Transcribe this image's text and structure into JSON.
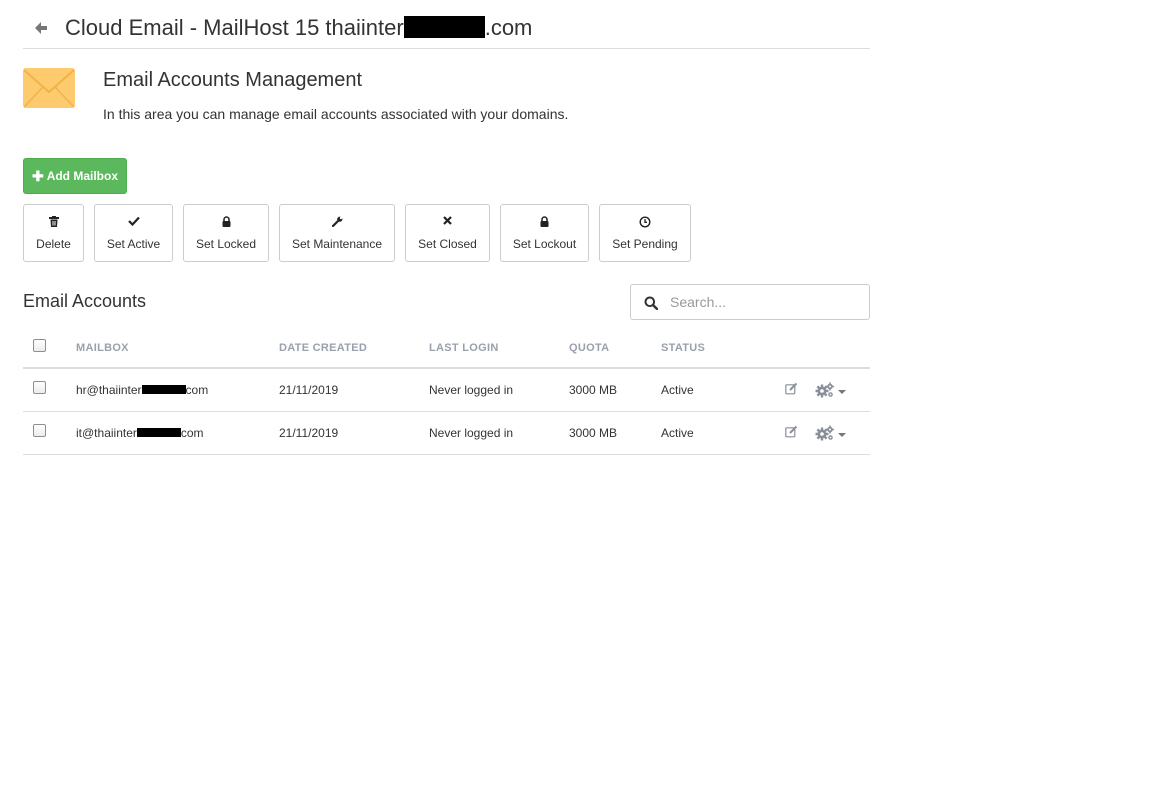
{
  "header": {
    "title_prefix": "Cloud Email - MailHost 15 thaiinter",
    "title_suffix": ".com"
  },
  "intro": {
    "title": "Email Accounts Management",
    "description": "In this area you can manage email accounts associated with your domains."
  },
  "toolbar": {
    "add_mailbox_label": "Add Mailbox",
    "actions": [
      {
        "label": "Delete",
        "icon": "trash-icon"
      },
      {
        "label": "Set Active",
        "icon": "check-icon"
      },
      {
        "label": "Set Locked",
        "icon": "lock-icon"
      },
      {
        "label": "Set Maintenance",
        "icon": "wrench-icon"
      },
      {
        "label": "Set Closed",
        "icon": "close-icon"
      },
      {
        "label": "Set Lockout",
        "icon": "lock-icon"
      },
      {
        "label": "Set Pending",
        "icon": "clock-icon"
      }
    ]
  },
  "accounts": {
    "title": "Email Accounts",
    "search_placeholder": "Search...",
    "columns": [
      "MAILBOX",
      "DATE CREATED",
      "LAST LOGIN",
      "QUOTA",
      "STATUS"
    ],
    "rows": [
      {
        "mailbox_prefix": "hr@thaiinter",
        "mailbox_suffix": "com",
        "date_created": "21/11/2019",
        "last_login": "Never logged in",
        "quota": "3000 MB",
        "status": "Active"
      },
      {
        "mailbox_prefix": "it@thaiinter",
        "mailbox_suffix": "com",
        "date_created": "21/11/2019",
        "last_login": "Never logged in",
        "quota": "3000 MB",
        "status": "Active"
      }
    ]
  },
  "colors": {
    "primary_green": "#5cb85c",
    "envelope_yellow": "#fdcb6e",
    "header_text_gray": "#9aa0ac"
  }
}
